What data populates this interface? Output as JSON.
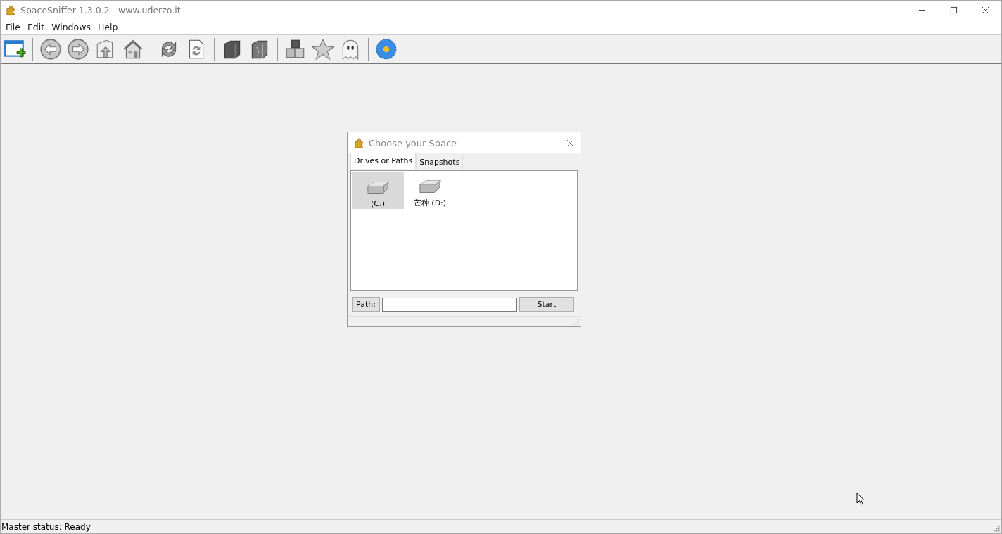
{
  "window": {
    "title": "SpaceSniffer 1.3.0.2 - www.uderzo.it"
  },
  "menu": [
    "File",
    "Edit",
    "Windows",
    "Help"
  ],
  "dialog": {
    "title": "Choose your Space",
    "tabs": [
      {
        "label": "Drives or Paths",
        "selected": true
      },
      {
        "label": "Snapshots",
        "selected": false
      }
    ],
    "drives": [
      {
        "label": "(C:)",
        "selected": true
      },
      {
        "label": "芒种 (D:)",
        "selected": false
      }
    ],
    "path_label": "Path:",
    "start_button": "Start"
  },
  "status_bar": "Master status: Ready"
}
